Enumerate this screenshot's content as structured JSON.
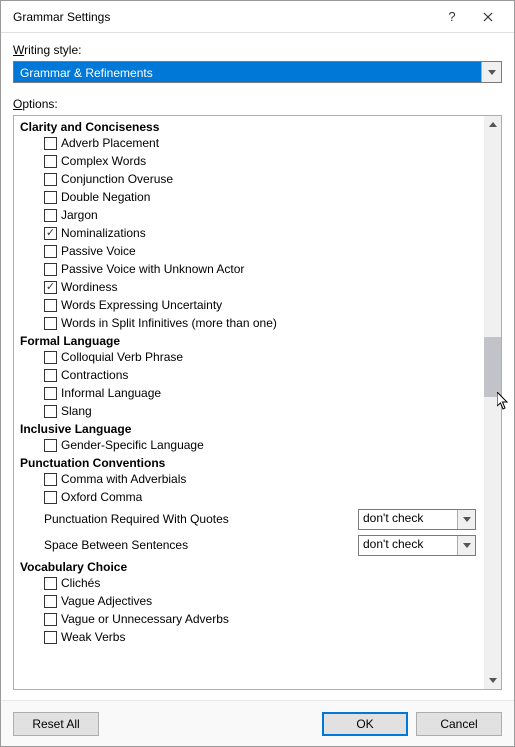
{
  "title": "Grammar Settings",
  "writing_style_label": "Writing style:",
  "writing_style_value": "Grammar & Refinements",
  "options_label": "Options:",
  "groups": [
    {
      "header": "Clarity and Conciseness",
      "items": [
        {
          "label": "Adverb Placement",
          "checked": false
        },
        {
          "label": "Complex Words",
          "checked": false
        },
        {
          "label": "Conjunction Overuse",
          "checked": false
        },
        {
          "label": "Double Negation",
          "checked": false
        },
        {
          "label": "Jargon",
          "checked": false
        },
        {
          "label": "Nominalizations",
          "checked": true
        },
        {
          "label": "Passive Voice",
          "checked": false
        },
        {
          "label": "Passive Voice with Unknown Actor",
          "checked": false
        },
        {
          "label": "Wordiness",
          "checked": true
        },
        {
          "label": "Words Expressing Uncertainty",
          "checked": false
        },
        {
          "label": "Words in Split Infinitives (more than one)",
          "checked": false
        }
      ]
    },
    {
      "header": "Formal Language",
      "items": [
        {
          "label": "Colloquial Verb Phrase",
          "checked": false
        },
        {
          "label": "Contractions",
          "checked": false
        },
        {
          "label": "Informal Language",
          "checked": false
        },
        {
          "label": "Slang",
          "checked": false
        }
      ]
    },
    {
      "header": "Inclusive Language",
      "items": [
        {
          "label": "Gender-Specific Language",
          "checked": false
        }
      ]
    },
    {
      "header": "Punctuation Conventions",
      "items": [
        {
          "label": "Comma with Adverbials",
          "checked": false
        },
        {
          "label": "Oxford Comma",
          "checked": false
        }
      ],
      "selects": [
        {
          "label": "Punctuation Required With Quotes",
          "value": "don't check"
        },
        {
          "label": "Space Between Sentences",
          "value": "don't check"
        }
      ]
    },
    {
      "header": "Vocabulary Choice",
      "items": [
        {
          "label": "Clichés",
          "checked": false
        },
        {
          "label": "Vague Adjectives",
          "checked": false
        },
        {
          "label": "Vague or Unnecessary Adverbs",
          "checked": false
        },
        {
          "label": "Weak Verbs",
          "checked": false
        }
      ]
    }
  ],
  "buttons": {
    "reset": "Reset All",
    "ok": "OK",
    "cancel": "Cancel"
  }
}
